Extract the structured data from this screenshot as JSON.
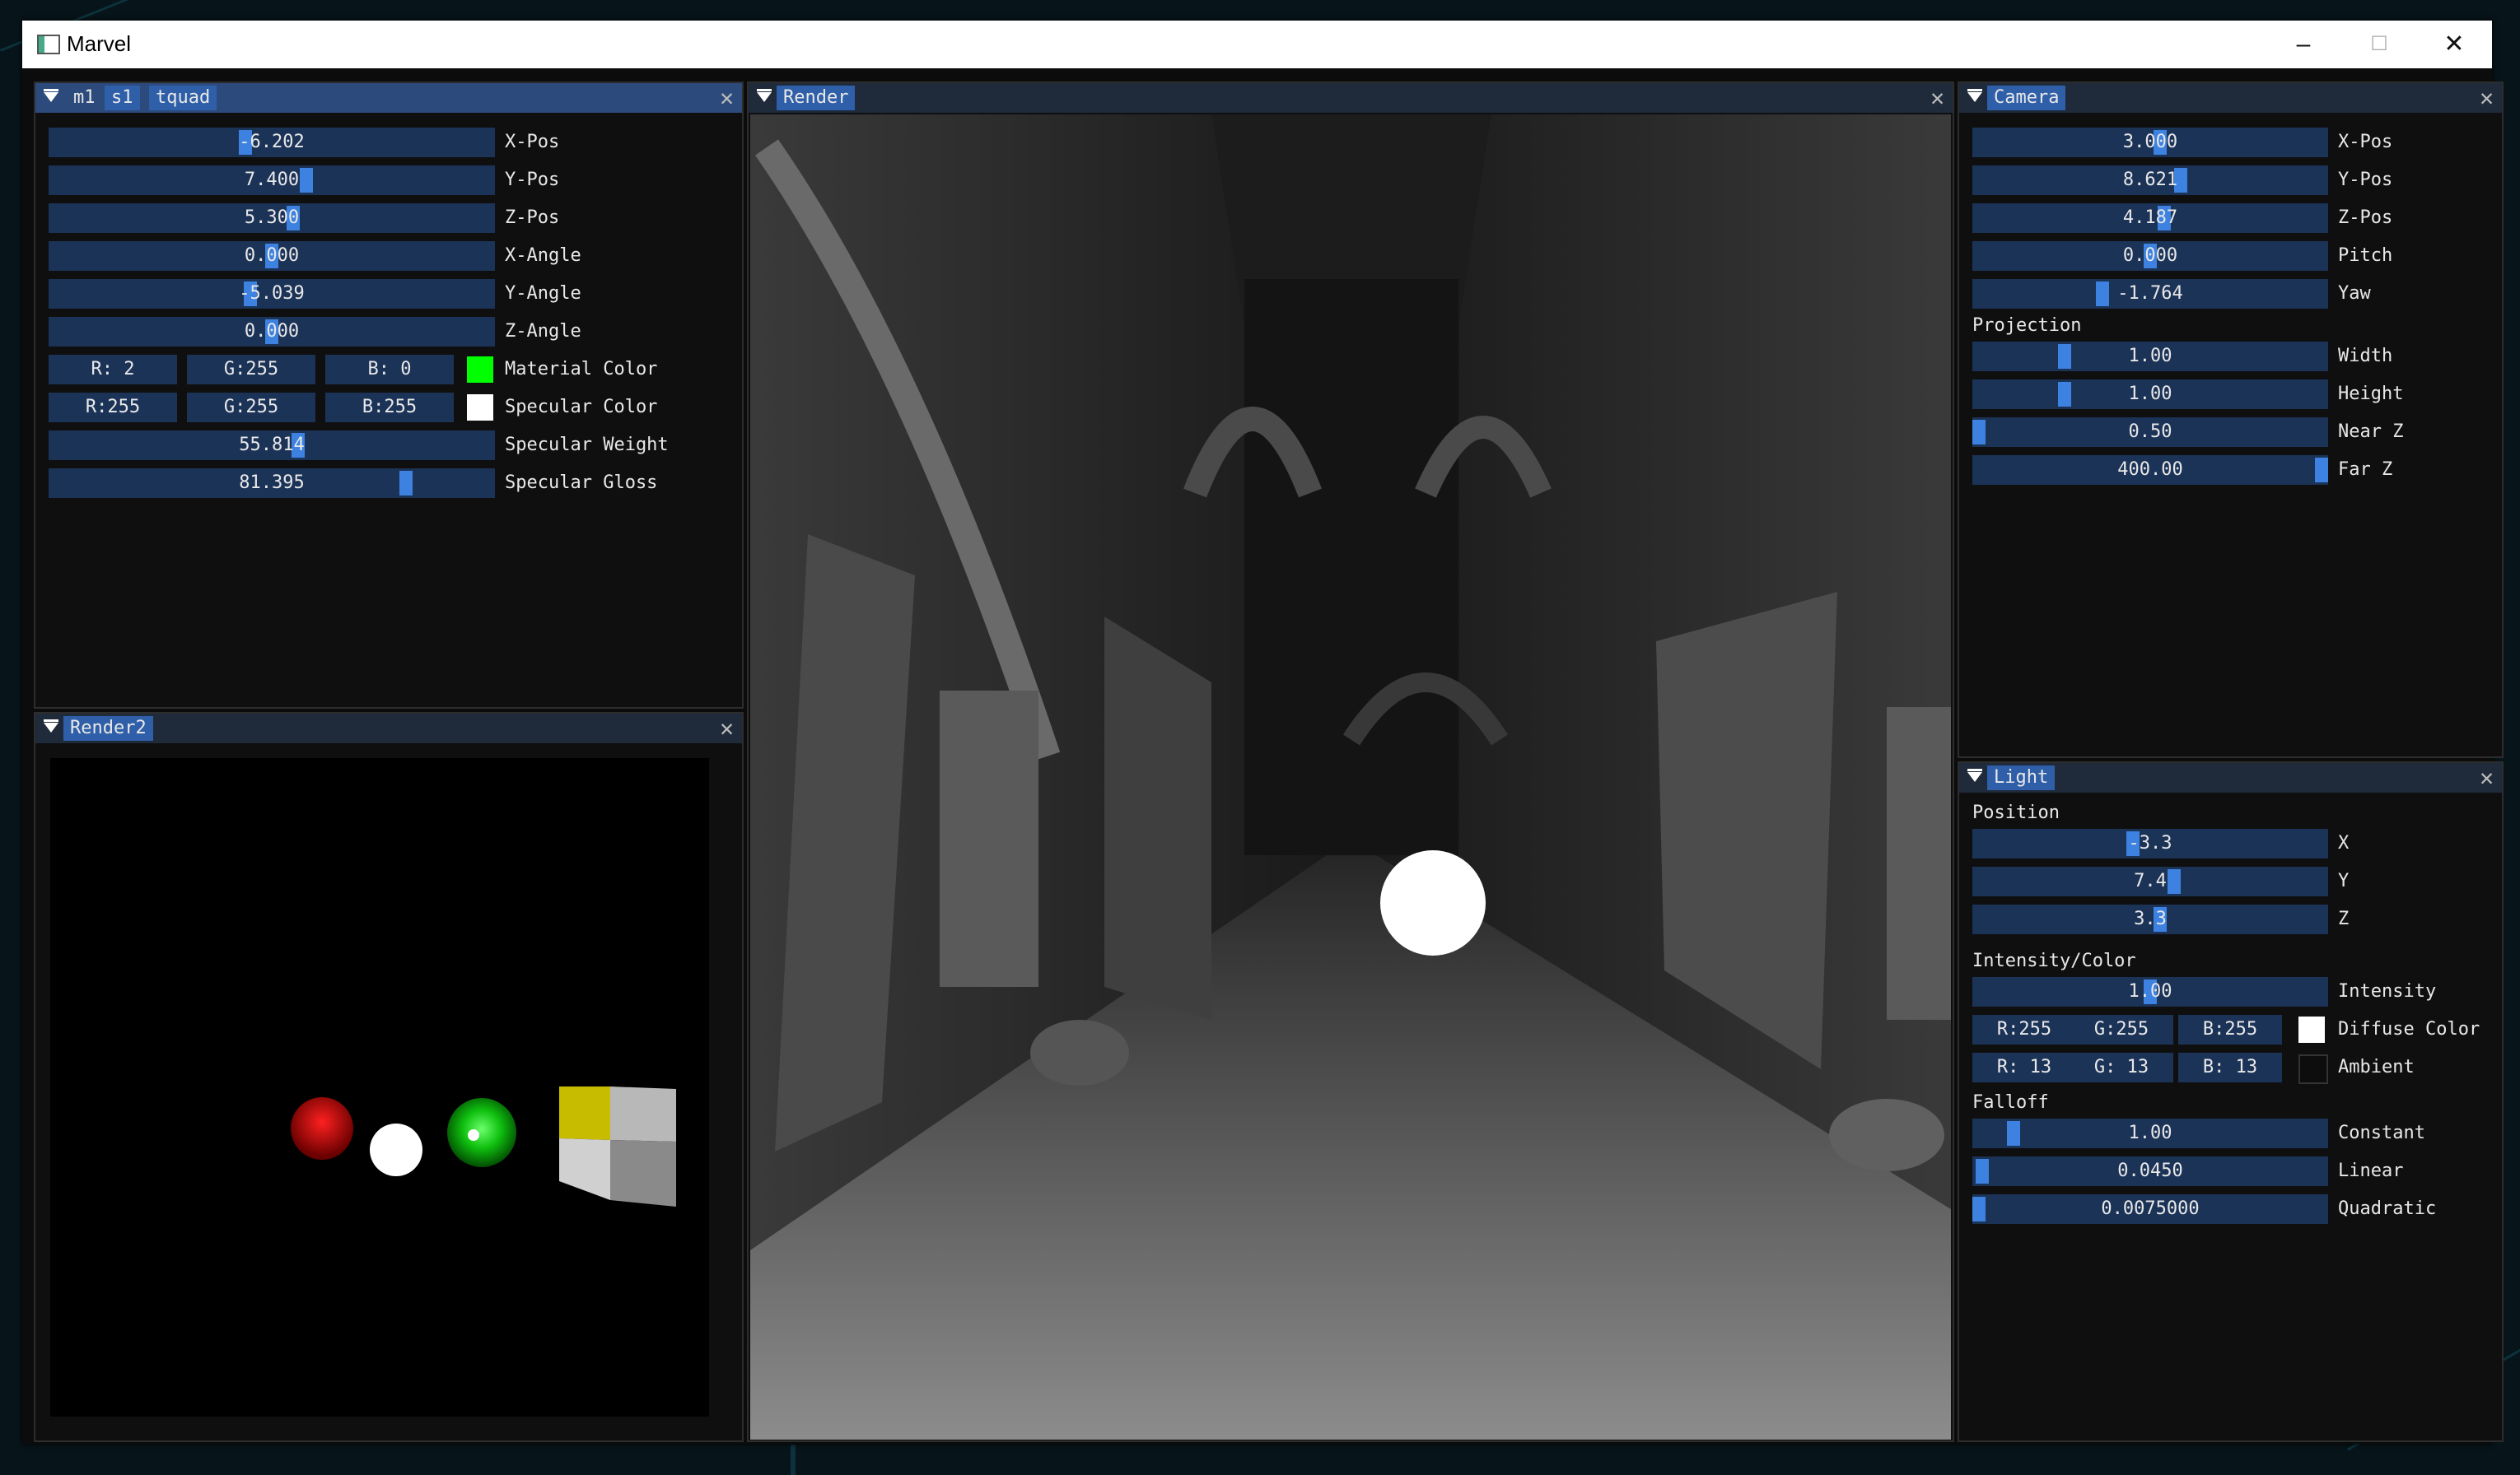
{
  "window": {
    "title": "Marvel",
    "minimize": "–",
    "maximize": "☐",
    "close": "✕"
  },
  "material_panel": {
    "tabs": [
      "m1",
      "s1",
      "tquad"
    ],
    "close": "✕",
    "sliders": [
      {
        "value": "-6.202",
        "label": "X-Pos",
        "level": 0.44
      },
      {
        "value": "7.400",
        "label": "Y-Pos",
        "level": 0.58
      },
      {
        "value": "5.300",
        "label": "Z-Pos",
        "level": 0.55
      },
      {
        "value": "0.000",
        "label": "X-Angle",
        "level": 0.5
      },
      {
        "value": "-5.039",
        "label": "Y-Angle",
        "level": 0.45
      },
      {
        "value": "0.000",
        "label": "Z-Angle",
        "level": 0.5
      }
    ],
    "material_color": {
      "r": "R:  2",
      "g": "G:255",
      "b": "B:  0",
      "label": "Material Color",
      "swatch": "#00ff00"
    },
    "specular_color": {
      "r": "R:255",
      "g": "G:255",
      "b": "B:255",
      "label": "Specular Color",
      "swatch": "#ffffff"
    },
    "specular_weight": {
      "value": "55.814",
      "label": "Specular Weight",
      "level": 0.56
    },
    "specular_gloss": {
      "value": "81.395",
      "label": "Specular Gloss",
      "level": 0.81
    }
  },
  "render2_panel": {
    "tab": "Render2",
    "close": "✕"
  },
  "render_panel": {
    "tab": "Render",
    "close": "✕"
  },
  "camera_panel": {
    "tab": "Camera",
    "close": "✕",
    "sliders": [
      {
        "value": "3.000",
        "label": "X-Pos",
        "level": 0.53
      },
      {
        "value": "8.621",
        "label": "Y-Pos",
        "level": 0.59
      },
      {
        "value": "4.187",
        "label": "Z-Pos",
        "level": 0.54
      },
      {
        "value": "0.000",
        "label": "Pitch",
        "level": 0.5
      },
      {
        "value": "-1.764",
        "label": "Yaw",
        "level": 0.36
      }
    ],
    "projection_header": "Projection",
    "projection": [
      {
        "value": "1.00",
        "label": "Width",
        "level": 0.25
      },
      {
        "value": "1.00",
        "label": "Height",
        "level": 0.25
      },
      {
        "value": "0.50",
        "label": "Near Z",
        "level": 0.0
      },
      {
        "value": "400.00",
        "label": "Far Z",
        "level": 1.0
      }
    ]
  },
  "light_panel": {
    "tab": "Light",
    "close": "✕",
    "position_header": "Position",
    "position": [
      {
        "value": "-3.3",
        "label": "X",
        "level": 0.45
      },
      {
        "value": "7.4",
        "label": "Y",
        "level": 0.57
      },
      {
        "value": "3.3",
        "label": "Z",
        "level": 0.53
      }
    ],
    "intensity_header": "Intensity/Color",
    "intensity": {
      "value": "1.00",
      "label": "Intensity",
      "level": 0.5
    },
    "diffuse_color": {
      "r": "R:255",
      "g": "G:255",
      "b": "B:255",
      "label": "Diffuse Color",
      "swatch": "#ffffff"
    },
    "ambient": {
      "r": "R: 13",
      "g": "G: 13",
      "b": "B: 13",
      "label": "Ambient",
      "swatch": "#0d0d0d"
    },
    "falloff_header": "Falloff",
    "falloff": [
      {
        "value": "1.00",
        "label": "Constant",
        "level": 0.1
      },
      {
        "value": "0.0450",
        "label": "Linear",
        "level": 0.01
      },
      {
        "value": "0.0075000",
        "label": "Quadratic",
        "level": 0.0
      }
    ]
  }
}
